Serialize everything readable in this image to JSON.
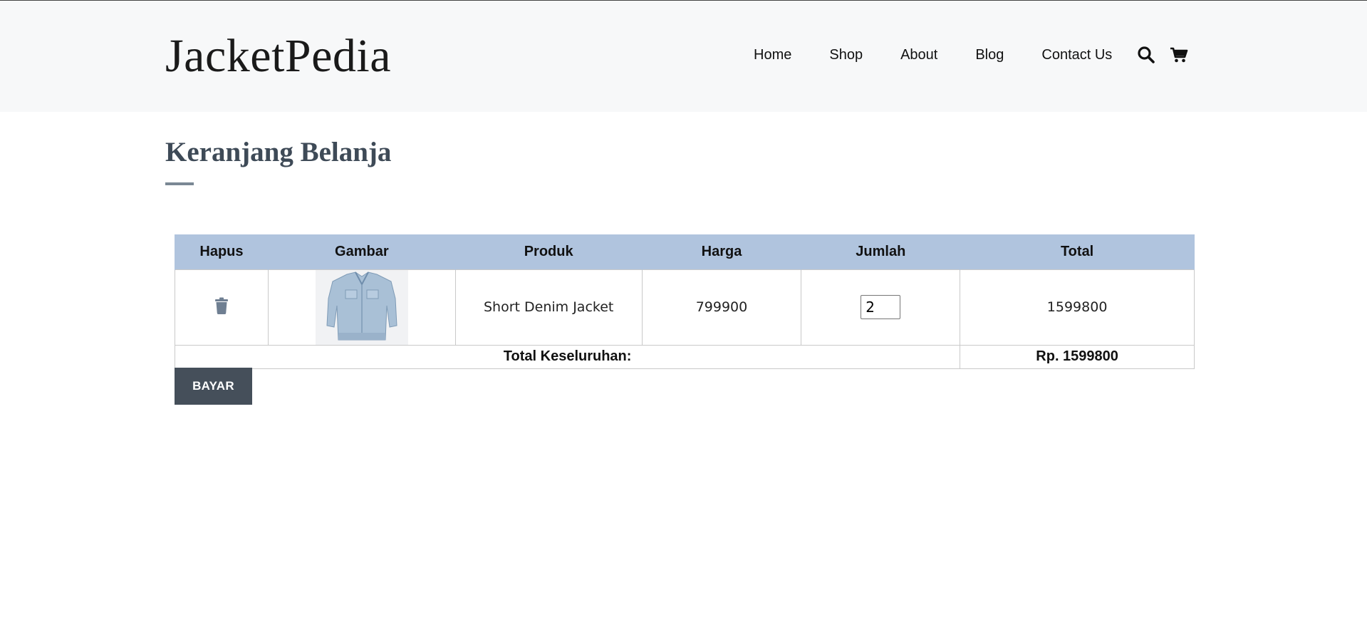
{
  "brand": {
    "logo_text": "JacketPedia"
  },
  "nav": {
    "items": [
      "Home",
      "Shop",
      "About",
      "Blog",
      "Contact Us"
    ],
    "icons": [
      "search-icon",
      "cart-icon"
    ]
  },
  "cart": {
    "title": "Keranjang Belanja",
    "columns": [
      "Hapus",
      "Gambar",
      "Produk",
      "Harga",
      "Jumlah",
      "Total"
    ],
    "items": [
      {
        "delete_icon": "trash-icon",
        "image": "light-blue denim jacket",
        "product": "Short Denim Jacket",
        "price": "799900",
        "quantity": "2",
        "total": "1599800"
      }
    ],
    "grand_total_label": "Total Keseluruhan:",
    "grand_total_value": "Rp. 1599800",
    "pay_label": "BAYAR"
  },
  "colors": {
    "header_bg": "#f7f8f9",
    "table_header_bg": "#b0c4de",
    "button_bg": "#454f5a",
    "title": "#3e4a57"
  }
}
